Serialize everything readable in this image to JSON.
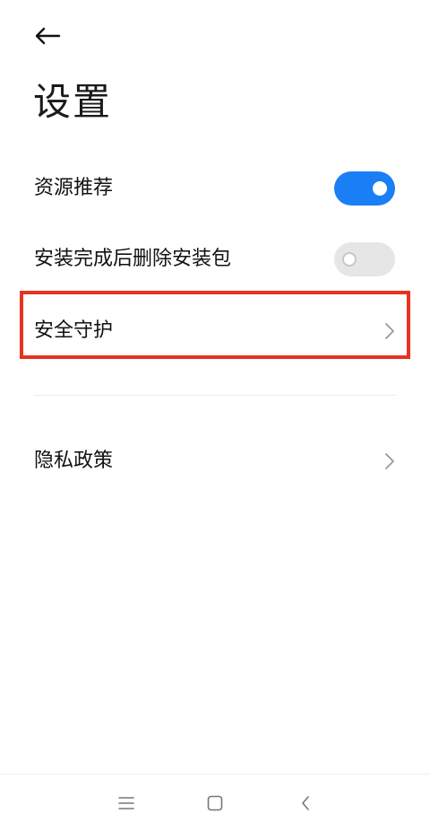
{
  "header": {
    "back_icon": "arrow-left-icon",
    "title": "设置"
  },
  "settings": [
    {
      "label": "资源推荐",
      "control": "toggle",
      "state": "on"
    },
    {
      "label": "安装完成后删除安装包",
      "control": "toggle",
      "state": "off"
    },
    {
      "label": "安全守护",
      "control": "chevron",
      "highlighted": true
    },
    {
      "label": "隐私政策",
      "control": "chevron"
    }
  ],
  "navbar": {
    "menu_icon": "menu-icon",
    "home_icon": "home-square-icon",
    "back_icon": "back-chevron-icon"
  },
  "colors": {
    "toggle_on": "#1a7ff4",
    "toggle_off": "#e6e6e6",
    "highlight_border": "#e8321e"
  }
}
